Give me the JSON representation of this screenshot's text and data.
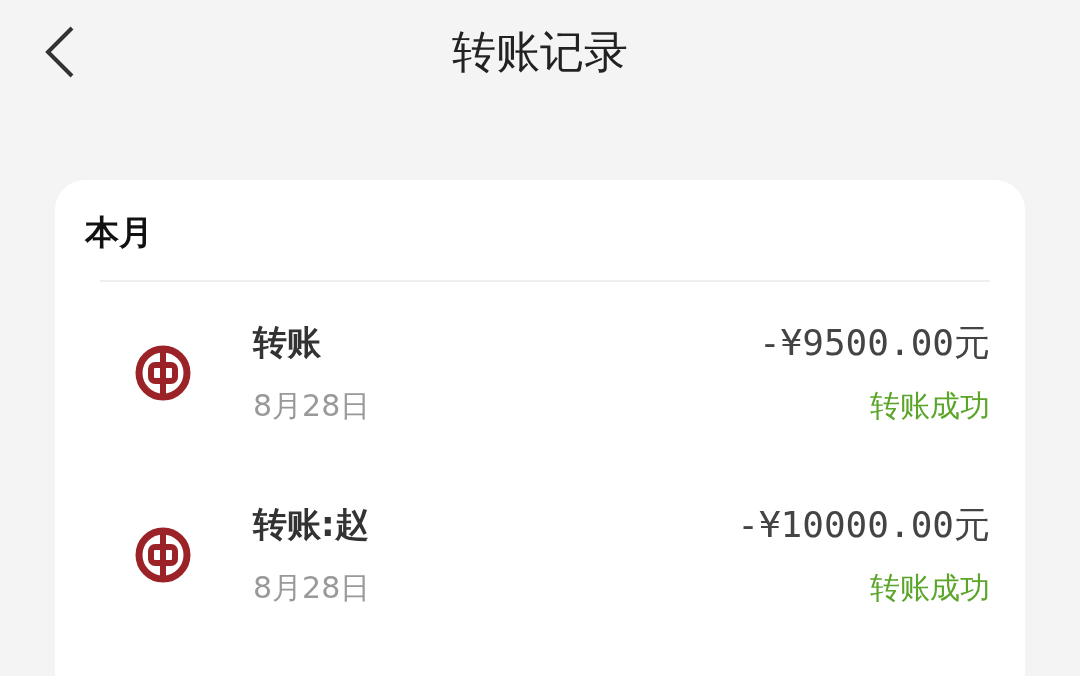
{
  "header": {
    "title": "转账记录"
  },
  "section": {
    "title": "本月",
    "records": [
      {
        "name": "转账",
        "date": "8月28日",
        "amount": "-¥9500.00元",
        "status": "转账成功"
      },
      {
        "name": "转账:赵",
        "date": "8月28日",
        "amount": "-¥10000.00元",
        "status": "转账成功"
      }
    ]
  }
}
